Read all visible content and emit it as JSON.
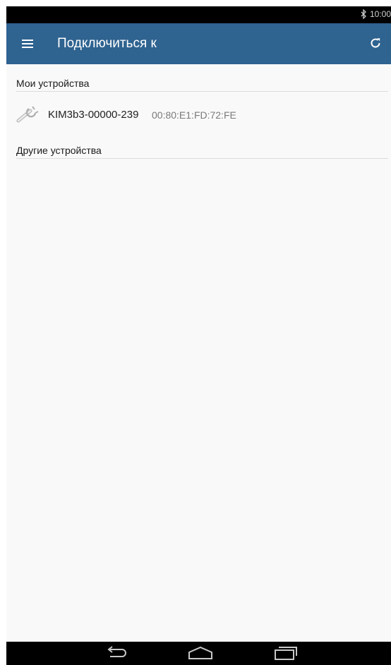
{
  "status_bar": {
    "time": "10:00",
    "icons": [
      "bluetooth-icon"
    ]
  },
  "app_bar": {
    "title": "Подключиться к",
    "left_icon": "menu-icon",
    "right_icon": "refresh-icon",
    "background_color": "#2f6390"
  },
  "sections": {
    "my_devices": {
      "title": "Мои устройства",
      "devices": [
        {
          "icon": "wrench-icon",
          "name": "KIM3b3-00000-239",
          "mac": "00:80:E1:FD:72:FE"
        }
      ]
    },
    "other_devices": {
      "title": "Другие устройства",
      "devices": []
    }
  },
  "nav_bar": {
    "buttons": [
      "back-icon",
      "home-icon",
      "recent-apps-icon"
    ]
  }
}
